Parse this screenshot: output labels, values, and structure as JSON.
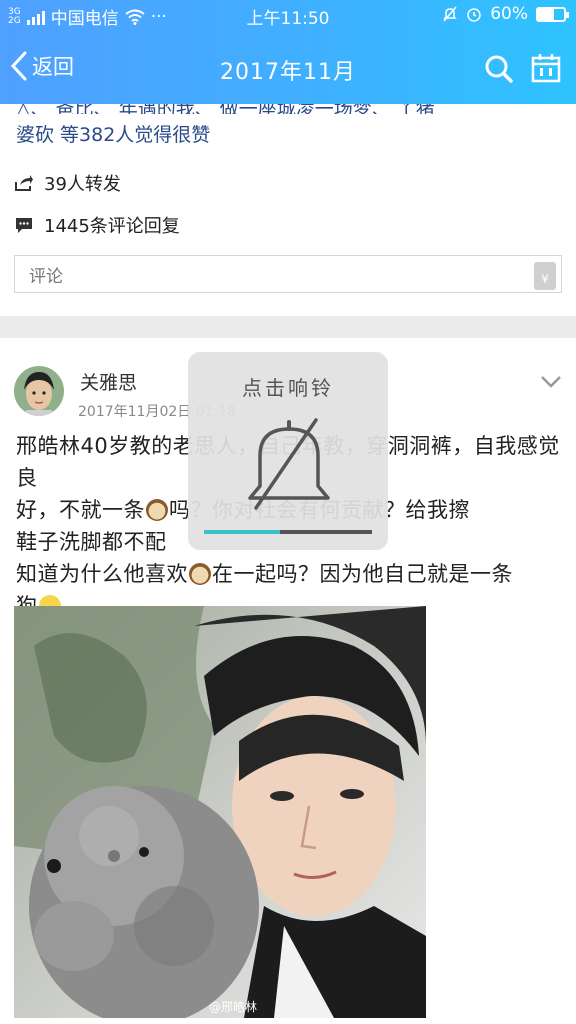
{
  "status_bar": {
    "network_type_top": "3G",
    "network_type_bottom": "2G",
    "carrier": "中国电信",
    "more": "···",
    "time": "上午11:50",
    "battery_percent": "60%",
    "battery_level": 0.6
  },
  "nav": {
    "back_label": "返回",
    "title": "2017年11月",
    "icons": [
      "chevron-left-icon",
      "search-icon",
      "calendar-icon"
    ]
  },
  "previous_post": {
    "likes_partial_line": "△、 爸比、 年遇的我、 做一座城凌一场梦、 丫猪",
    "likes_text": "婆砍 等382人觉得很赞",
    "reposts": "39人转发",
    "comments": "1445条评论回复",
    "comment_placeholder": "评论",
    "red_packet_symbol": "¥"
  },
  "post": {
    "username": "关雅思",
    "time": "2017年11月02日 01:18",
    "text_line1": "邢皓林40岁教的老思人，",
    "text_line1_hidden": "自己年教，穿洞洞裤，自我感觉良",
    "text_line2_a": "好，不就一条",
    "text_line2_b": "吗？你",
    "text_line2_c": "对社会有何贡献？给我擦",
    "text_line3": "鞋子洗脚都不配",
    "text_line4_a": "知道为什么他喜欢",
    "text_line4_b": "在一起吗？因为他自己就是一条",
    "text_line5": "狗",
    "watermark": "@邢皓林"
  },
  "toast": {
    "title": "点击响铃",
    "progress": 0.45
  },
  "colors": {
    "header_start": "#4fa0ff",
    "header_end": "#2ec3ff",
    "progress_accent": "#3cc1c7"
  }
}
